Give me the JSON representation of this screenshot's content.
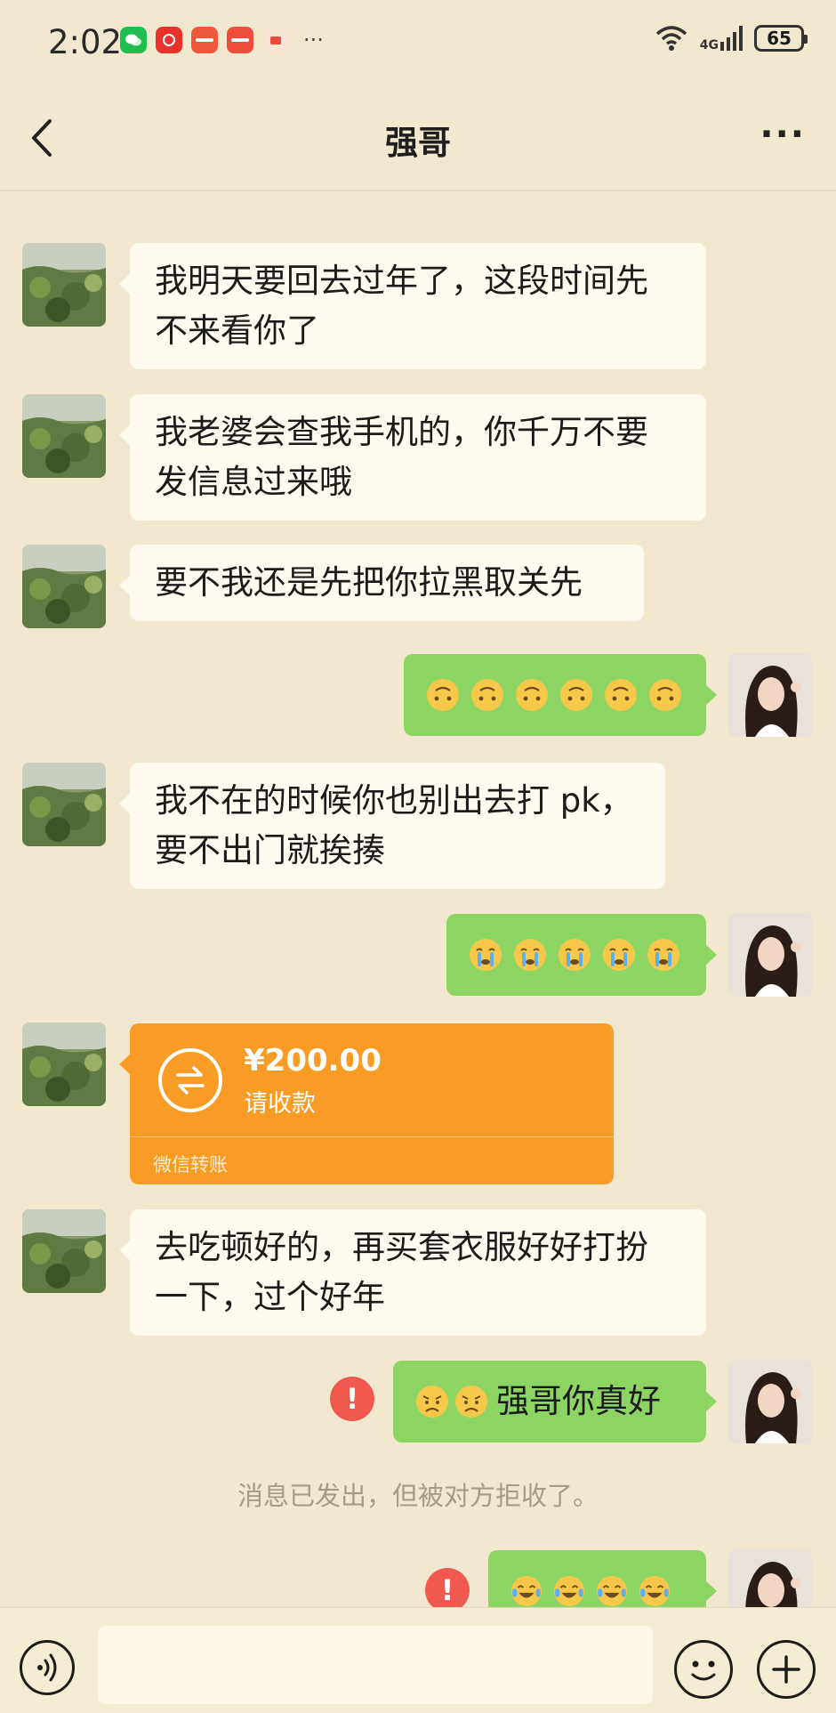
{
  "status_bar": {
    "time": "2:02",
    "more": "···",
    "network": "4G",
    "battery": "65"
  },
  "nav": {
    "title": "强哥",
    "more": "···"
  },
  "messages": {
    "m1": {
      "line1": "我明天要回去过年了，这段时间先",
      "line2": "不来看你了"
    },
    "m2": {
      "line1": "我老婆会查我手机的，你千万不要",
      "line2": "发信息过来哦"
    },
    "m3": {
      "text": "要不我还是先把你拉黑取关先"
    },
    "m5": {
      "line1": "我不在的时候你也别出去打 pk，",
      "line2": "要不出门就挨揍"
    },
    "m8": {
      "line1": "去吃顿好的，再买套衣服好好打扮",
      "line2": "一下，过个好年"
    },
    "m9": {
      "text": "强哥你真好"
    }
  },
  "transfer": {
    "amount": "¥200.00",
    "desc": "请收款",
    "footer": "微信转账"
  },
  "system_note": "消息已发出，但被对方拒收了。",
  "emoji_sets": {
    "m4": "upside-down-face ×6",
    "m6": "crying-face ×5",
    "m9": "sad-face ×2",
    "m10": "tears-of-joy ×4"
  },
  "colors": {
    "background": "#f1e8cf",
    "left_bubble": "#fffaf0",
    "right_bubble": "#8cd563",
    "transfer": "#f99c25",
    "error": "#f05a4e"
  }
}
